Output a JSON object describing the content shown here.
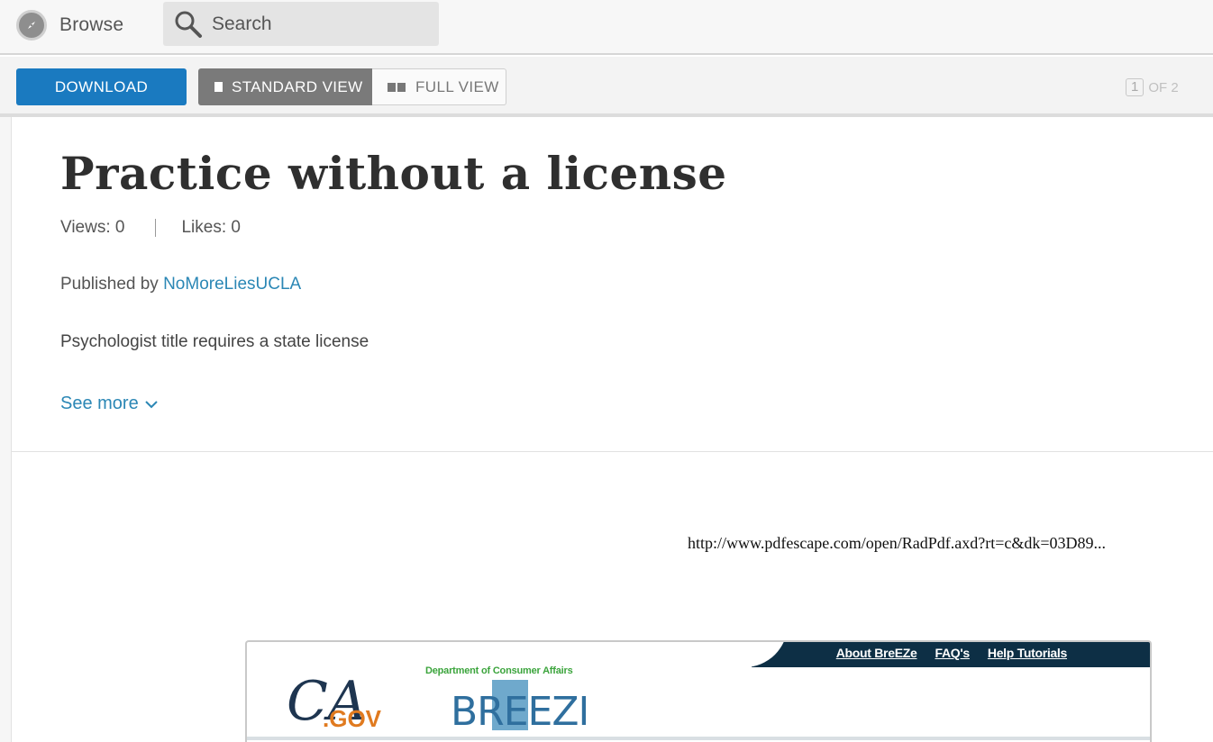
{
  "topbar": {
    "browse_label": "Browse",
    "search_label": "Search"
  },
  "toolbar": {
    "download_label": "DOWNLOAD",
    "standard_view_label": "STANDARD VIEW",
    "full_view_label": "FULL VIEW",
    "current_page": "1",
    "page_total": "OF 2"
  },
  "document": {
    "title": "Practice without a license",
    "views": "Views: 0",
    "likes": "Likes: 0",
    "published_prefix": "Published by",
    "publisher": "NoMoreLiesUCLA",
    "description": "Psychologist title requires a state license",
    "see_more_label": "See more"
  },
  "page_preview": {
    "url_text": "http://www.pdfescape.com/open/RadPdf.axd?rt=c&dk=03D89...",
    "header_links": [
      "About BreEZe",
      "FAQ's",
      "Help Tutorials"
    ],
    "agency_text": "Department of Consumer Affairs",
    "ca_logo_text": "CA",
    "gov_logo_text": ".GOV",
    "breeze_logo_text": "BREEZE"
  },
  "colors": {
    "accent_blue": "#1a7ac0",
    "link_blue": "#2b87b5",
    "active_view_gray": "#7a7a7a",
    "breeze_navy": "#0d2f45",
    "breeze_green": "#3ba43c",
    "gov_orange": "#e07a1f"
  },
  "icons": {
    "browse": "compass-icon",
    "search": "magnifier-icon",
    "standard_view": "single-page-icon",
    "full_view": "double-page-icon",
    "see_more": "chevron-down-icon"
  }
}
